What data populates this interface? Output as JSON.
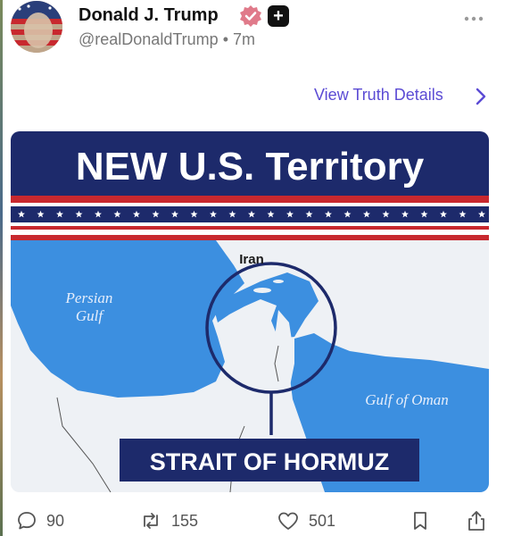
{
  "post": {
    "author_name": "Donald J. Trump",
    "handle": "@realDonaldTrump",
    "separator": "•",
    "time_ago": "7m",
    "view_details_label": "View Truth Details",
    "more_icon": "ellipsis-icon",
    "verified_icon": "verified-badge-icon",
    "plus_icon": "plus-badge-icon",
    "accent_color": "#5b4bd4"
  },
  "image": {
    "banner_title": "NEW U.S. Territory",
    "label_iran": "Iran",
    "label_persian_gulf_1": "Persian",
    "label_persian_gulf_2": "Gulf",
    "label_gulf_of_oman": "Gulf of Oman",
    "callout": "STRAIT OF HORMUZ",
    "colors": {
      "navy": "#1d2a6b",
      "red": "#c8282e",
      "water": "#3c8fe0",
      "land": "#eef1f5"
    }
  },
  "actions": {
    "reply": {
      "icon": "reply-icon",
      "count": "90"
    },
    "retruth": {
      "icon": "retruth-icon",
      "count": "155"
    },
    "like": {
      "icon": "heart-icon",
      "count": "501"
    },
    "bookmark": {
      "icon": "bookmark-icon"
    },
    "share": {
      "icon": "share-icon"
    }
  }
}
